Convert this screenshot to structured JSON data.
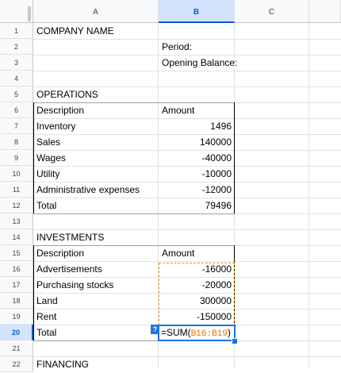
{
  "columns": [
    "A",
    "B",
    "C"
  ],
  "selected_column": "B",
  "rows": [
    "1",
    "2",
    "3",
    "4",
    "5",
    "6",
    "7",
    "8",
    "9",
    "10",
    "11",
    "12",
    "13",
    "14",
    "15",
    "16",
    "17",
    "18",
    "19",
    "20",
    "21",
    "22"
  ],
  "selected_row": "20",
  "cells": {
    "A1": "COMPANY NAME",
    "B2": "Period:",
    "B3": "Opening Balance:",
    "A5": "OPERATIONS",
    "A6": "Description",
    "B6": "Amount",
    "A7": "Inventory",
    "B7": "1496",
    "A8": "Sales",
    "B8": "140000",
    "A9": "Wages",
    "B9": "-40000",
    "A10": "Utility",
    "B10": "-10000",
    "A11": "Administrative expenses",
    "B11": "-12000",
    "A12": "Total",
    "B12": "79496",
    "A14": "INVESTMENTS",
    "A15": "Description",
    "B15": "Amount",
    "A16": "Advertisements",
    "B16": "-16000",
    "A17": "Purchasing stocks",
    "B17": "-20000",
    "A18": "Land",
    "B18": "300000",
    "A19": "Rent",
    "B19": "-150000",
    "A20": "Total",
    "A22": "FINANCING"
  },
  "editor": {
    "help_label": "?",
    "prefix": "=SUM(",
    "range": "B16:B19",
    "suffix": ")"
  },
  "colors": {
    "selection": "#1a73e8",
    "range_highlight": "#f29900",
    "header_selected_bg": "#d3e3fd"
  }
}
